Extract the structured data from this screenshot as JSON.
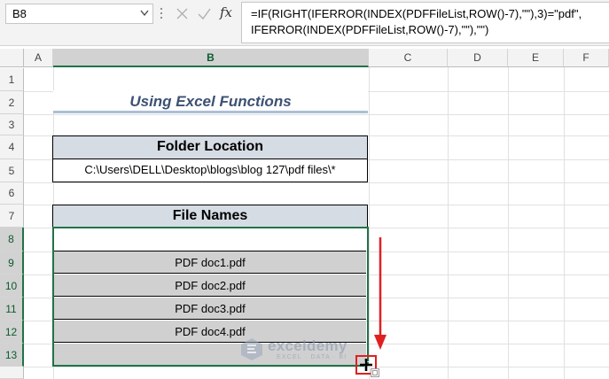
{
  "formula_bar": {
    "name_box": "B8",
    "fx_label": "fx",
    "formula_line1": "=IF(RIGHT(IFERROR(INDEX(PDFFileList,ROW()-7),\"\"),3)=\"pdf\",",
    "formula_line2": "IFERROR(INDEX(PDFFileList,ROW()-7),\"\"),\"\")"
  },
  "columns": [
    "A",
    "B",
    "C",
    "D",
    "E",
    "F"
  ],
  "rows": [
    "1",
    "2",
    "3",
    "4",
    "5",
    "6",
    "7",
    "8",
    "9",
    "10",
    "11",
    "12",
    "13"
  ],
  "sheet": {
    "title": "Using Excel Functions",
    "folder_header": "Folder Location",
    "folder_path": "C:\\Users\\DELL\\Desktop\\blogs\\blog 127\\pdf files\\*",
    "files_header": "File Names",
    "files": [
      "",
      "PDF doc1.pdf",
      "PDF doc2.pdf",
      "PDF doc3.pdf",
      "PDF doc4.pdf",
      ""
    ]
  },
  "watermark": {
    "name": "exceldemy",
    "tagline": "EXCEL · DATA · BI"
  },
  "colors": {
    "accent_green": "#217346",
    "annotation_red": "#e02020",
    "header_fill": "#d6dce4",
    "title_color": "#3c5173"
  }
}
